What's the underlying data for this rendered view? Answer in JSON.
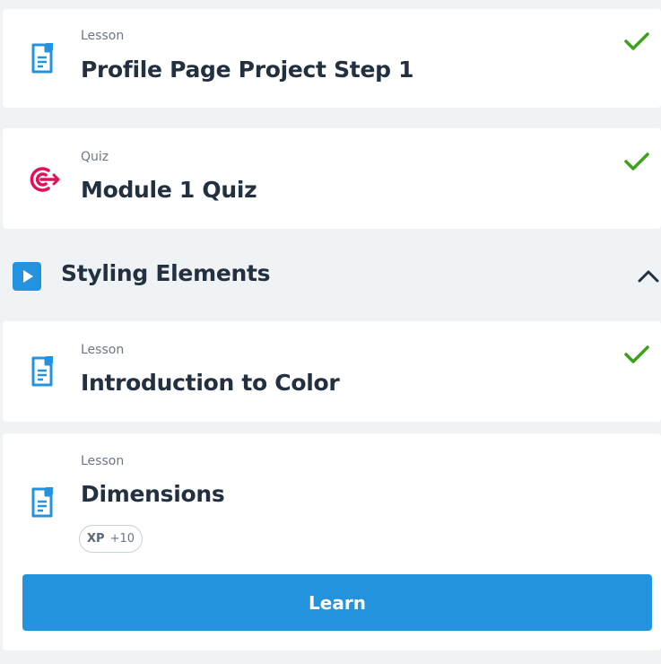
{
  "items": [
    {
      "type": "Lesson",
      "title": "Profile Page Project Step 1",
      "icon": "lesson-doc-icon",
      "completed": true
    },
    {
      "type": "Quiz",
      "title": "Module 1 Quiz",
      "icon": "quiz-target-icon",
      "completed": true
    }
  ],
  "section": {
    "title": "Styling Elements",
    "icon": "play-icon",
    "expanded": true
  },
  "section_items": [
    {
      "type": "Lesson",
      "title": "Introduction to Color",
      "icon": "lesson-doc-icon",
      "completed": true
    },
    {
      "type": "Lesson",
      "title": "Dimensions",
      "icon": "lesson-doc-icon",
      "completed": false,
      "xp_label": "XP",
      "xp_value": "+10",
      "button": "Learn"
    }
  ],
  "colors": {
    "background": "#f0f3f6",
    "card": "#ffffff",
    "lesson_icon": "#2493df",
    "quiz_icon": "#e1105c",
    "check": "#3ba319",
    "button": "#2493df",
    "section_icon": "#2493df"
  }
}
